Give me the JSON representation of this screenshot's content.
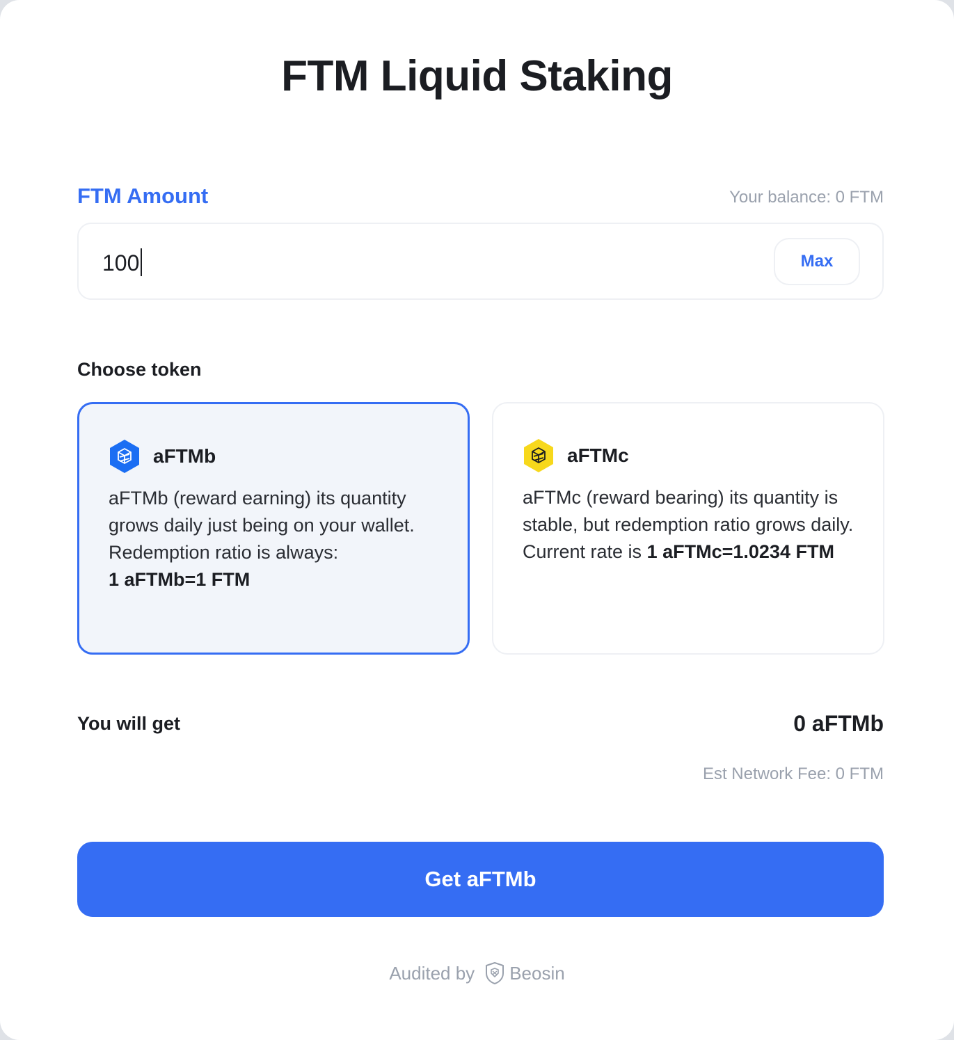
{
  "page": {
    "title": "FTM Liquid Staking"
  },
  "amount": {
    "label": "FTM Amount",
    "balance": "Your balance: 0 FTM",
    "value": "100",
    "max_label": "Max"
  },
  "tokens": {
    "label": "Choose token",
    "items": [
      {
        "name": "aFTMb",
        "icon": "aftmb-hexagon-icon",
        "icon_color": "#1b6ef3",
        "selected": true,
        "desc": "aFTMb (reward earning) its quantity grows daily just being on your wallet. Redemption ratio is always:",
        "rate": "1 aFTMb=1 FTM"
      },
      {
        "name": "aFTMc",
        "icon": "aftmc-hexagon-icon",
        "icon_color": "#f7d81c",
        "selected": false,
        "desc": "aFTMc (reward bearing) its quantity is stable, but redemption ratio grows daily.",
        "rate_prefix": "Current rate is",
        "rate": "1 aFTMc=1.0234 FTM"
      }
    ]
  },
  "summary": {
    "get_label": "You will get",
    "get_value": "0 aFTMb",
    "fee": "Est Network Fee: 0 FTM"
  },
  "submit": {
    "label": "Get aFTMb"
  },
  "footer": {
    "audited_by": "Audited by",
    "auditor": "Beosin",
    "auditor_icon": "beosin-shield-icon"
  },
  "colors": {
    "accent": "#356df3",
    "muted": "#9aa1ad",
    "text": "#1b1d22"
  }
}
